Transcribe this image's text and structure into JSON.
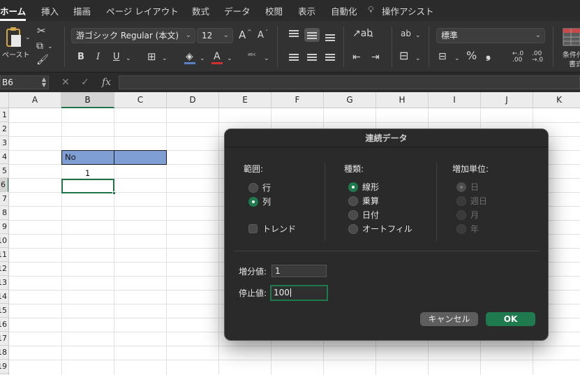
{
  "ribbon_tabs": [
    "ホーム",
    "挿入",
    "描画",
    "ページ レイアウト",
    "数式",
    "データ",
    "校閲",
    "表示",
    "自動化",
    "操作アシスト"
  ],
  "ribbon": {
    "paste_label": "ペースト",
    "font_name": "游ゴシック Regular (本文)",
    "font_size": "12",
    "number_format": "標準",
    "conditional_format_label": "条件付",
    "conditional_format_label_2": "書式",
    "bold": "B",
    "italic": "I",
    "underline": "U",
    "grow_font": "A",
    "shrink_font": "A",
    "font_color": "A",
    "percent": "%",
    "comma": "❟",
    "increase_decimal": "←.0\n.00",
    "wrap_text": "ab",
    "accent_color": "#217346"
  },
  "formula_bar": {
    "name_box": "B6",
    "fx": "fx",
    "value": ""
  },
  "sheet": {
    "columns": [
      "A",
      "B",
      "C",
      "D",
      "E",
      "F",
      "G",
      "H",
      "I",
      "J",
      "K"
    ],
    "selected_column": "B",
    "rows": [
      "1",
      "2",
      "3",
      "4",
      "5",
      "6",
      "7",
      "8",
      "9",
      "10",
      "11",
      "12",
      "13",
      "14",
      "15",
      "16",
      "17",
      "18",
      "19"
    ],
    "selected_row": "6",
    "cells": {
      "B4": "No",
      "B5": "1"
    },
    "header_fill": "#7f9fd4"
  },
  "dialog": {
    "title": "連続データ",
    "range": {
      "label": "範囲:",
      "options": [
        "行",
        "列"
      ],
      "selected": "列"
    },
    "trend_label": "トレンド",
    "type": {
      "label": "種類:",
      "options": [
        "線形",
        "乗算",
        "日付",
        "オートフィル"
      ],
      "selected": "線形"
    },
    "date_unit": {
      "label": "増加単位:",
      "options": [
        "日",
        "週日",
        "月",
        "年"
      ],
      "selected": "日",
      "disabled": true
    },
    "step_label": "増分値:",
    "step_value": "1",
    "stop_label": "停止値:",
    "stop_value": "100",
    "cancel_label": "キャンセル",
    "ok_label": "OK"
  }
}
